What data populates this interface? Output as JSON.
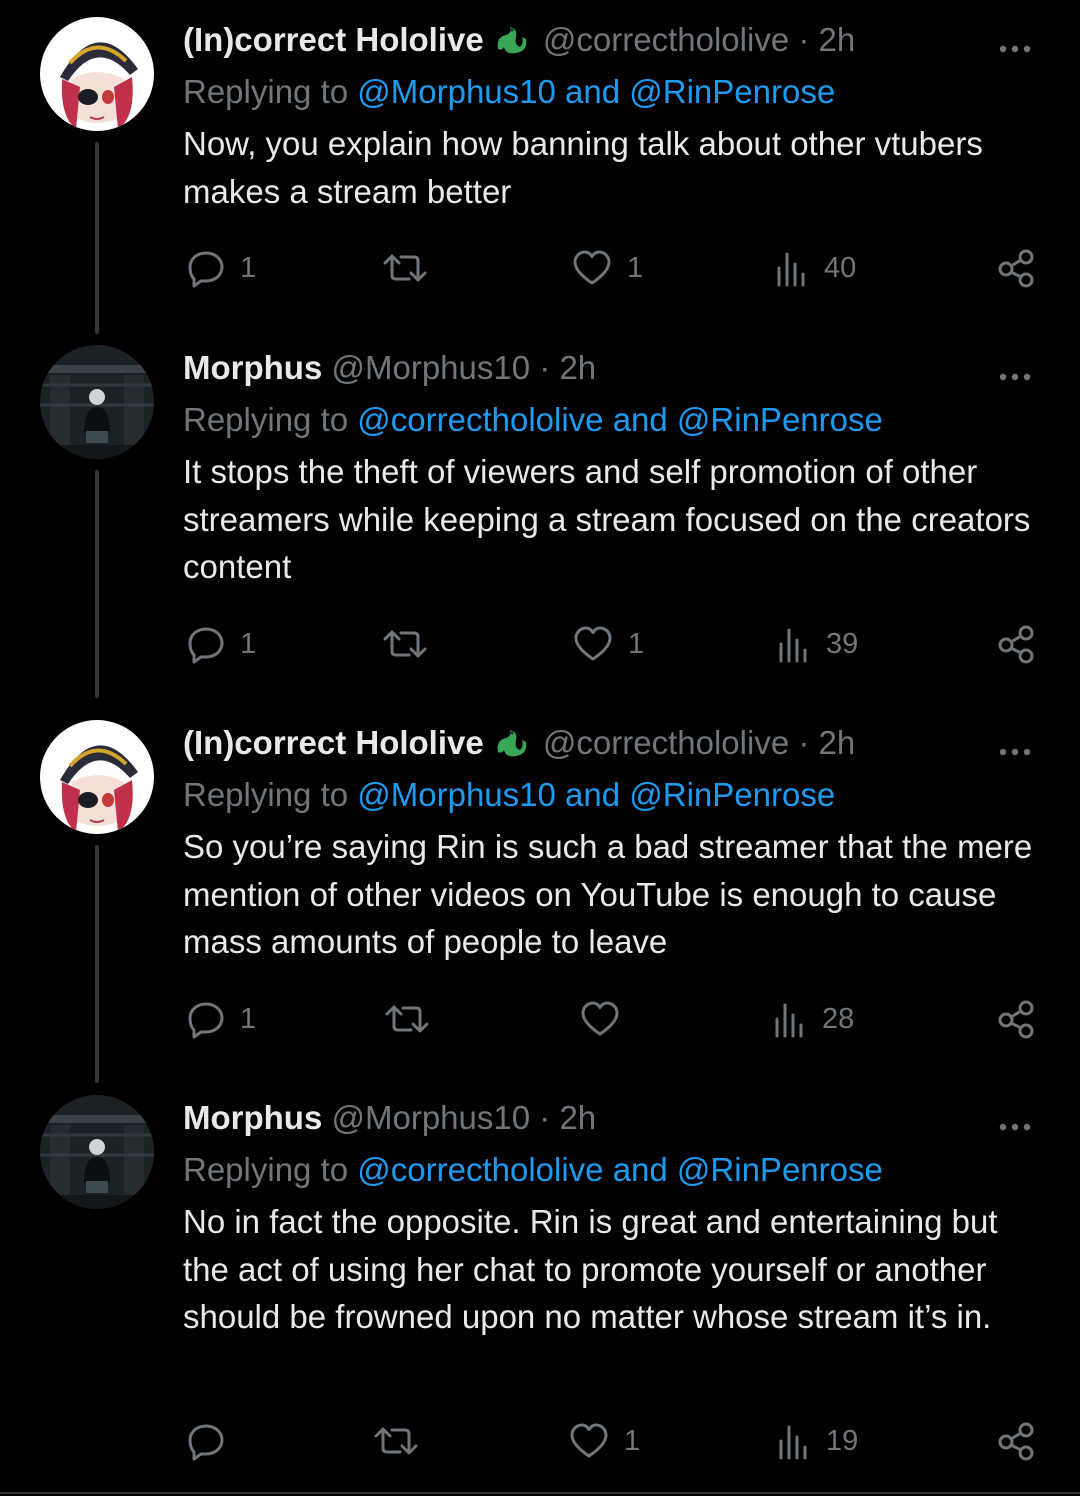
{
  "tweets": [
    {
      "name": "(In)correct Hololive",
      "verified_emoji": true,
      "handle": "@correcthololive",
      "dot": "·",
      "time": "2h",
      "replying_prefix": "Replying to ",
      "replying_links": "@Morphus10 and @RinPenrose",
      "text": "Now, you explain how banning talk about other vtubers makes a stream better",
      "replies": "1",
      "retweets": "",
      "likes": "1",
      "views": "40",
      "avatar": "pirate-anime-avatar"
    },
    {
      "name": "Morphus",
      "verified_emoji": false,
      "handle": "@Morphus10",
      "dot": "·",
      "time": "2h",
      "replying_prefix": "Replying to ",
      "replying_links": "@correcthololive and @RinPenrose",
      "text": "It stops the theft of viewers and self promotion of other streamers while keeping a stream focused on the creators content",
      "replies": "1",
      "retweets": "",
      "likes": "1",
      "views": "39",
      "avatar": "dark-scene-avatar"
    },
    {
      "name": "(In)correct Hololive",
      "verified_emoji": true,
      "handle": "@correcthololive",
      "dot": "·",
      "time": "2h",
      "replying_prefix": "Replying to ",
      "replying_links": "@Morphus10 and @RinPenrose",
      "text": "So you’re saying Rin is such a bad streamer that the mere mention of other videos on YouTube is enough to cause mass amounts of people to leave",
      "replies": "1",
      "retweets": "",
      "likes": "",
      "views": "28",
      "avatar": "pirate-anime-avatar"
    },
    {
      "name": "Morphus",
      "verified_emoji": false,
      "handle": "@Morphus10",
      "dot": "·",
      "time": "2h",
      "replying_prefix": "Replying to ",
      "replying_links": "@correcthololive and @RinPenrose",
      "text": "No in fact the opposite. Rin is great and entertaining but the act of using her chat to promote yourself or another should be frowned upon no matter whose stream it’s in.",
      "replies": "",
      "retweets": "",
      "likes": "1",
      "views": "19",
      "avatar": "dark-scene-avatar"
    }
  ],
  "colors": {
    "background": "#000000",
    "text": "#e7e9ea",
    "muted": "#71767b",
    "link": "#1d9bf0",
    "line": "#333639"
  },
  "icons": [
    "reply-icon",
    "retweet-icon",
    "like-icon",
    "views-icon",
    "share-icon",
    "more-icon",
    "dragon-emoji-icon"
  ]
}
